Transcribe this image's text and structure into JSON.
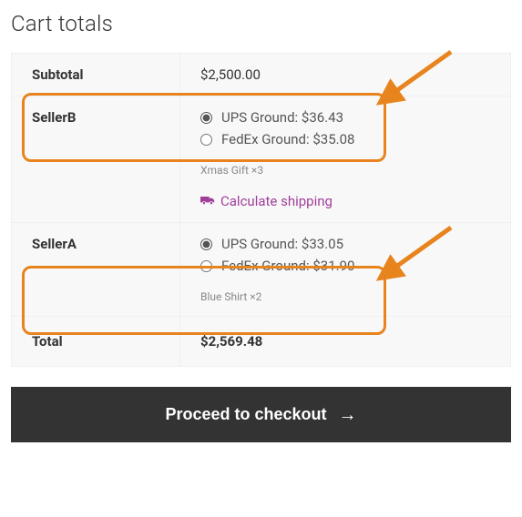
{
  "title": "Cart totals",
  "subtotal": {
    "label": "Subtotal",
    "value": "$2,500.00"
  },
  "sellers": [
    {
      "name": "SellerB",
      "options": [
        {
          "label": "UPS Ground:",
          "price": "$36.43",
          "selected": true
        },
        {
          "label": "FedEx Ground:",
          "price": "$35.08",
          "selected": false
        }
      ],
      "items_note": "Xmas Gift ×3",
      "show_calc": true
    },
    {
      "name": "SellerA",
      "options": [
        {
          "label": "UPS Ground:",
          "price": "$33.05",
          "selected": true
        },
        {
          "label": "FedEx Ground:",
          "price": "$31.90",
          "selected": false
        }
      ],
      "items_note": "Blue Shirt ×2",
      "show_calc": false
    }
  ],
  "calculate_shipping_label": "Calculate shipping",
  "total": {
    "label": "Total",
    "value": "$2,569.48"
  },
  "checkout_label": "Proceed to checkout",
  "annotation_color": "#e8841e"
}
